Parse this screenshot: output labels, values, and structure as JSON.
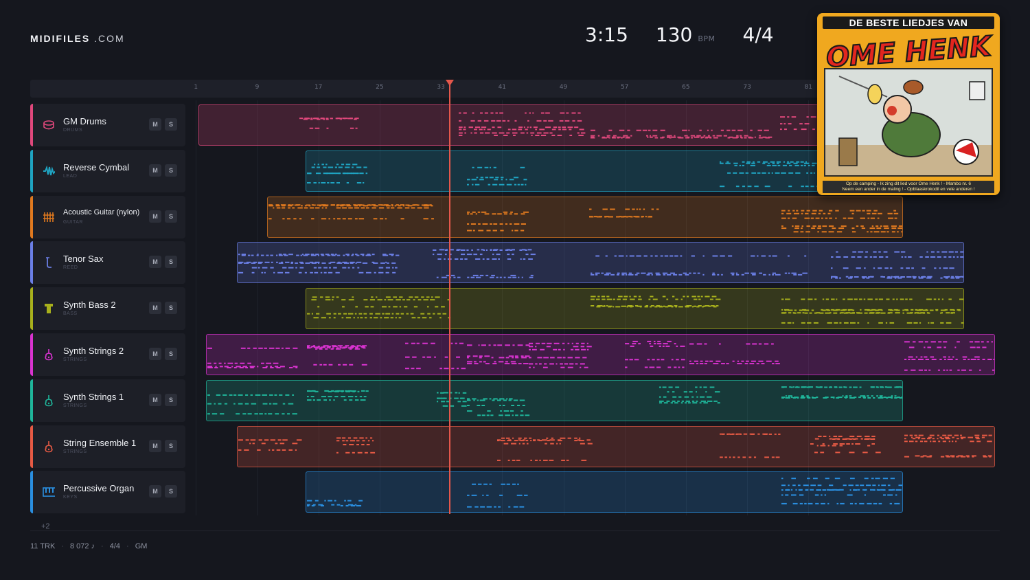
{
  "brand": {
    "bold": "MIDIFILES",
    "rest": " .COM"
  },
  "header": {
    "duration": "3:15",
    "bpm": "130",
    "bpm_unit": "BPM",
    "time_signature": "4/4"
  },
  "ruler": {
    "ticks": [
      "1",
      "9",
      "17",
      "25",
      "33",
      "41",
      "49",
      "57",
      "65",
      "73",
      "81"
    ]
  },
  "tracks": [
    {
      "name": "GM Drums",
      "category": "DRUMS",
      "color": "#e0487c",
      "icon": "drum-icon",
      "mute": "M",
      "solo": "S"
    },
    {
      "name": "Reverse Cymbal",
      "category": "LEAD",
      "color": "#1fa4c2",
      "icon": "waveform-icon",
      "mute": "M",
      "solo": "S"
    },
    {
      "name": "Acoustic Guitar (nylon)",
      "category": "GUITAR",
      "color": "#e0791f",
      "icon": "guitar-icon",
      "mute": "M",
      "solo": "S"
    },
    {
      "name": "Tenor Sax",
      "category": "REED",
      "color": "#6b7fe6",
      "icon": "sax-icon",
      "mute": "M",
      "solo": "S"
    },
    {
      "name": "Synth Bass 2",
      "category": "BASS",
      "color": "#a8b01c",
      "icon": "bass-icon",
      "mute": "M",
      "solo": "S"
    },
    {
      "name": "Synth Strings 2",
      "category": "STRINGS",
      "color": "#d933d0",
      "icon": "violin-icon",
      "mute": "M",
      "solo": "S"
    },
    {
      "name": "Synth Strings 1",
      "category": "STRINGS",
      "color": "#1fb59a",
      "icon": "violin-icon",
      "mute": "M",
      "solo": "S"
    },
    {
      "name": "String Ensemble 1",
      "category": "STRINGS",
      "color": "#e65a44",
      "icon": "violin-icon",
      "mute": "M",
      "solo": "S"
    },
    {
      "name": "Percussive Organ",
      "category": "KEYS",
      "color": "#2a8fe0",
      "icon": "keyboard-icon",
      "mute": "M",
      "solo": "S"
    }
  ],
  "more_tracks": "+2",
  "footer": {
    "tracks": "11 TRK",
    "notes": "8 072 ♪",
    "signature": "4/4",
    "standard": "GM",
    "separator": "·"
  },
  "cover": {
    "top": "DE BESTE LIEDJES VAN",
    "title": "OME HENK",
    "line1": "Op de camping - Ik zing dit lied voor Ome Henk ! - Mambo nr. 6",
    "line2": "Neem een ander in de maling ! - Opblaaskrokodil en vele anderen !"
  }
}
